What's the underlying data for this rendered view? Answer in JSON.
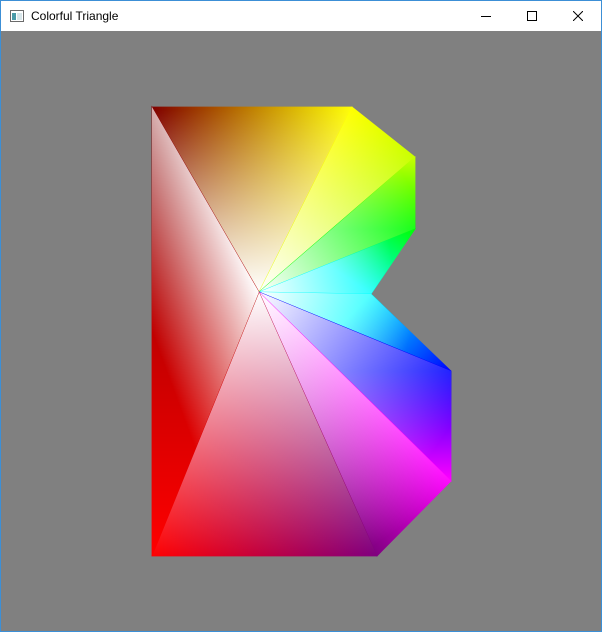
{
  "window": {
    "title": "Colorful Triangle",
    "client_background": "#808080",
    "controls": [
      "minimize-icon",
      "maximize-icon",
      "close-icon"
    ]
  },
  "shape": {
    "center_color": "#ffffff",
    "vertex_colors": [
      "#800000",
      "#ffff00",
      "#00ff00",
      "#00ffff",
      "#0000ff",
      "#ff00ff",
      "#800080",
      "#ff0000"
    ]
  }
}
